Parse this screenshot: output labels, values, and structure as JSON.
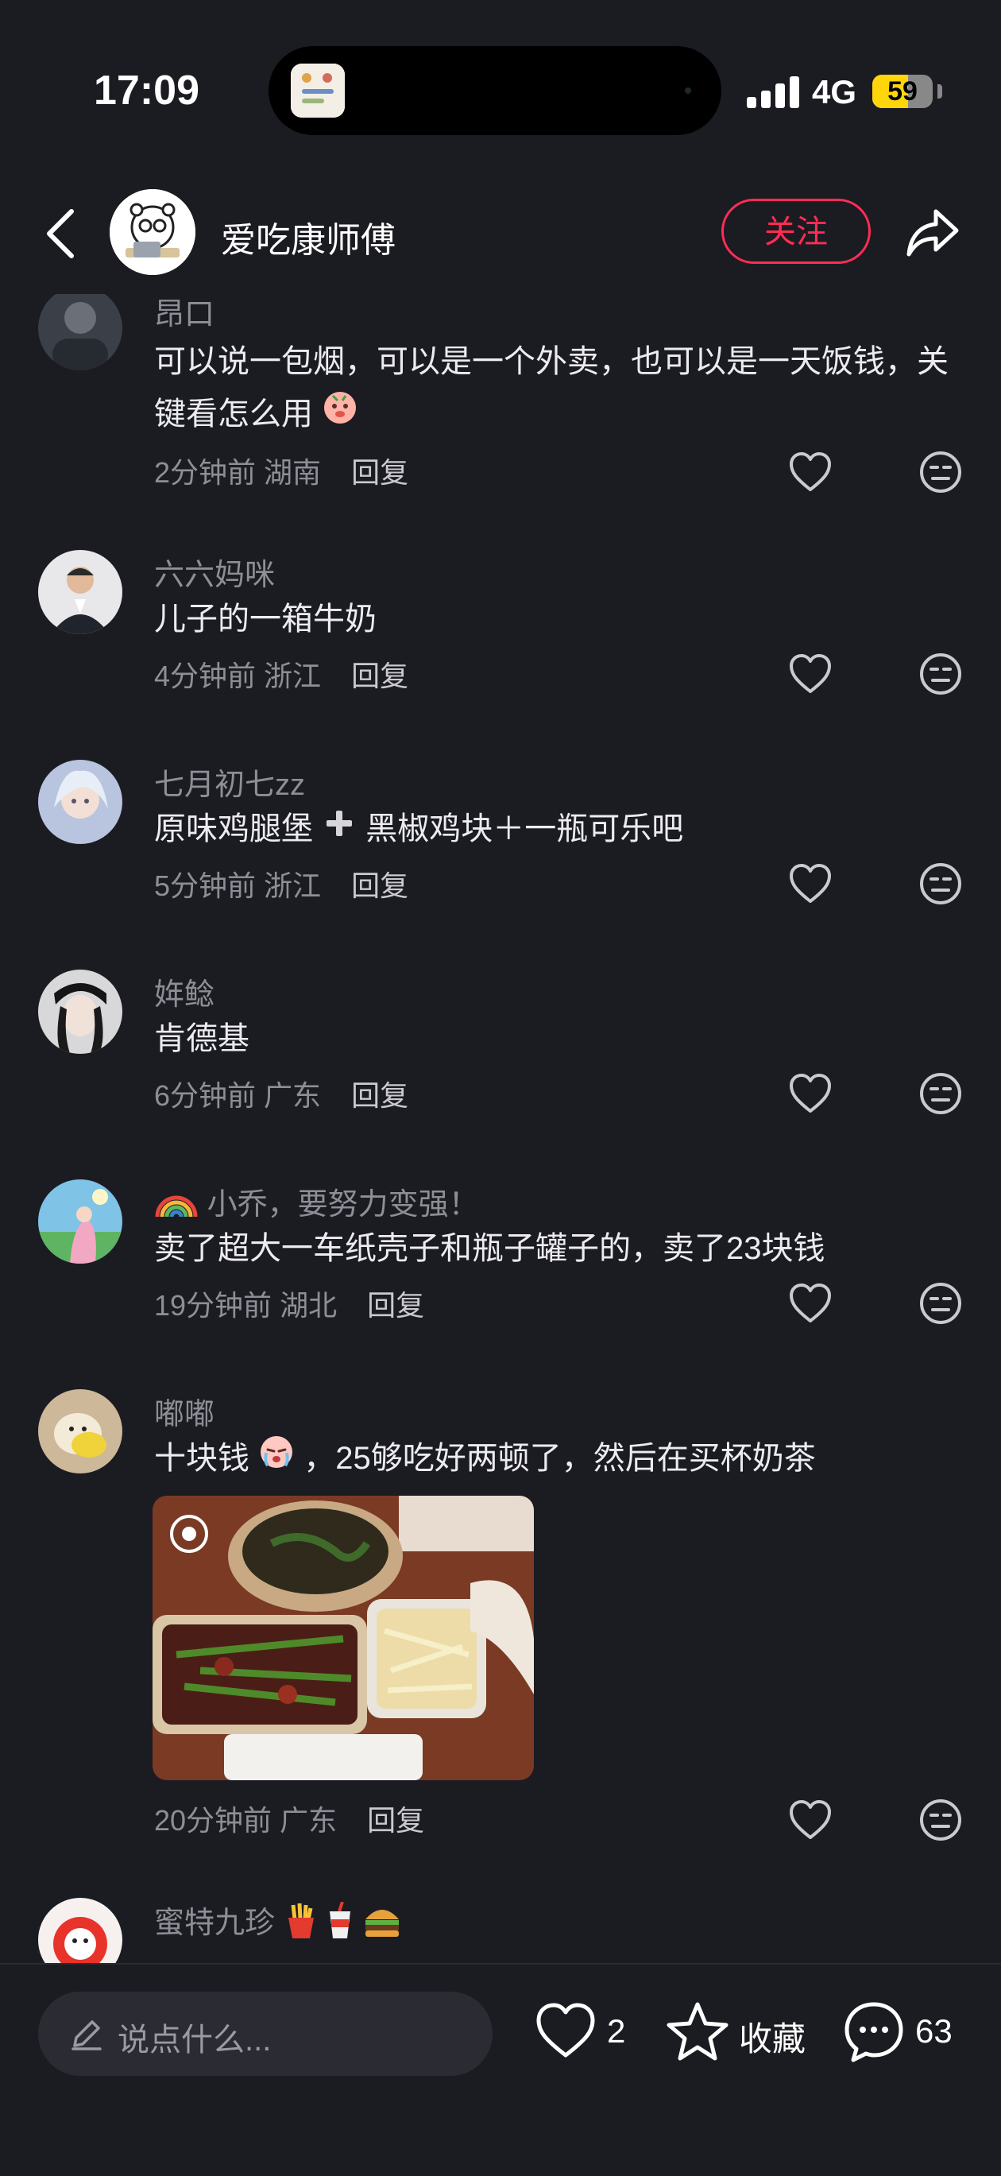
{
  "status_bar": {
    "time": "17:09",
    "network": "4G",
    "battery": "59",
    "battery_level": 0.59
  },
  "header": {
    "author_name": "爱吃康师傅",
    "follow_label": "关注"
  },
  "comments": [
    {
      "user": "昂口",
      "text": "可以说一包烟，可以是一个外卖，也可以是一天饭钱，关键看怎么用",
      "time": "2分钟前",
      "location": "湖南",
      "reply": "回复"
    },
    {
      "user": "六六妈咪",
      "text": "儿子的一箱牛奶",
      "time": "4分钟前",
      "location": "浙江",
      "reply": "回复"
    },
    {
      "user": "七月初七zz",
      "text_a": "原味鸡腿堡",
      "text_b": "黑椒鸡块＋一瓶可乐吧",
      "time": "5分钟前",
      "location": "浙江",
      "reply": "回复"
    },
    {
      "user": "姩鲶",
      "text": "肯德基",
      "time": "6分钟前",
      "location": "广东",
      "reply": "回复"
    },
    {
      "user": "小乔，要努力变强！",
      "text": "卖了超大一车纸壳子和瓶子罐子的，卖了23块钱",
      "time": "19分钟前",
      "location": "湖北",
      "reply": "回复"
    },
    {
      "user": "嘟嘟",
      "text_a": "十块钱",
      "text_b": "，25够吃好两顿了，然后在买杯奶茶",
      "time": "20分钟前",
      "location": "广东",
      "reply": "回复"
    },
    {
      "user": "蜜特九珍"
    }
  ],
  "bottom_bar": {
    "placeholder": "说点什么...",
    "likes": "2",
    "favorite_label": "收藏",
    "comments_count": "63"
  },
  "colors": {
    "background": "#1b1b22",
    "accent": "#ff2d55",
    "muted_text": "#8e8e96"
  },
  "icons": [
    "back-arrow-icon",
    "share-icon",
    "heart-icon",
    "meh-face-icon",
    "pencil-icon",
    "star-icon",
    "chat-bubble-icon"
  ]
}
